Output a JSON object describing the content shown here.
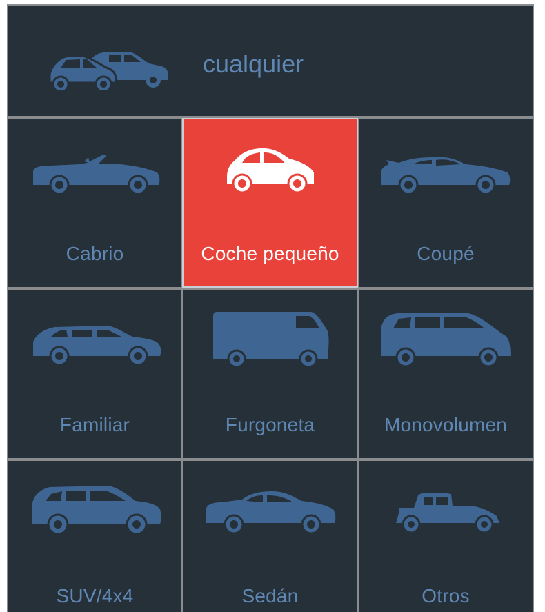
{
  "selector": {
    "any": {
      "label": "cualquier",
      "icon": "two-cars-icon"
    },
    "options": [
      {
        "label": "Cabrio",
        "icon": "convertible-car-icon",
        "selected": false
      },
      {
        "label": "Coche pequeño",
        "icon": "small-car-icon",
        "selected": true
      },
      {
        "label": "Coupé",
        "icon": "coupe-car-icon",
        "selected": false
      },
      {
        "label": "Familiar",
        "icon": "estate-car-icon",
        "selected": false
      },
      {
        "label": "Furgoneta",
        "icon": "van-icon",
        "selected": false
      },
      {
        "label": "Monovolumen",
        "icon": "minivan-icon",
        "selected": false
      },
      {
        "label": "SUV/4x4",
        "icon": "suv-icon",
        "selected": false
      },
      {
        "label": "Sedán",
        "icon": "sedan-car-icon",
        "selected": false
      },
      {
        "label": "Otros",
        "icon": "vintage-car-icon",
        "selected": false
      }
    ]
  },
  "colors": {
    "background": "#263038",
    "grid_lines": "#8a8c8d",
    "icon_and_label": "#3f6592",
    "label_text": "#5f87b4",
    "selected_background": "#e8423a",
    "selected_foreground": "#ffffff",
    "wheel_hub": "#263038"
  }
}
